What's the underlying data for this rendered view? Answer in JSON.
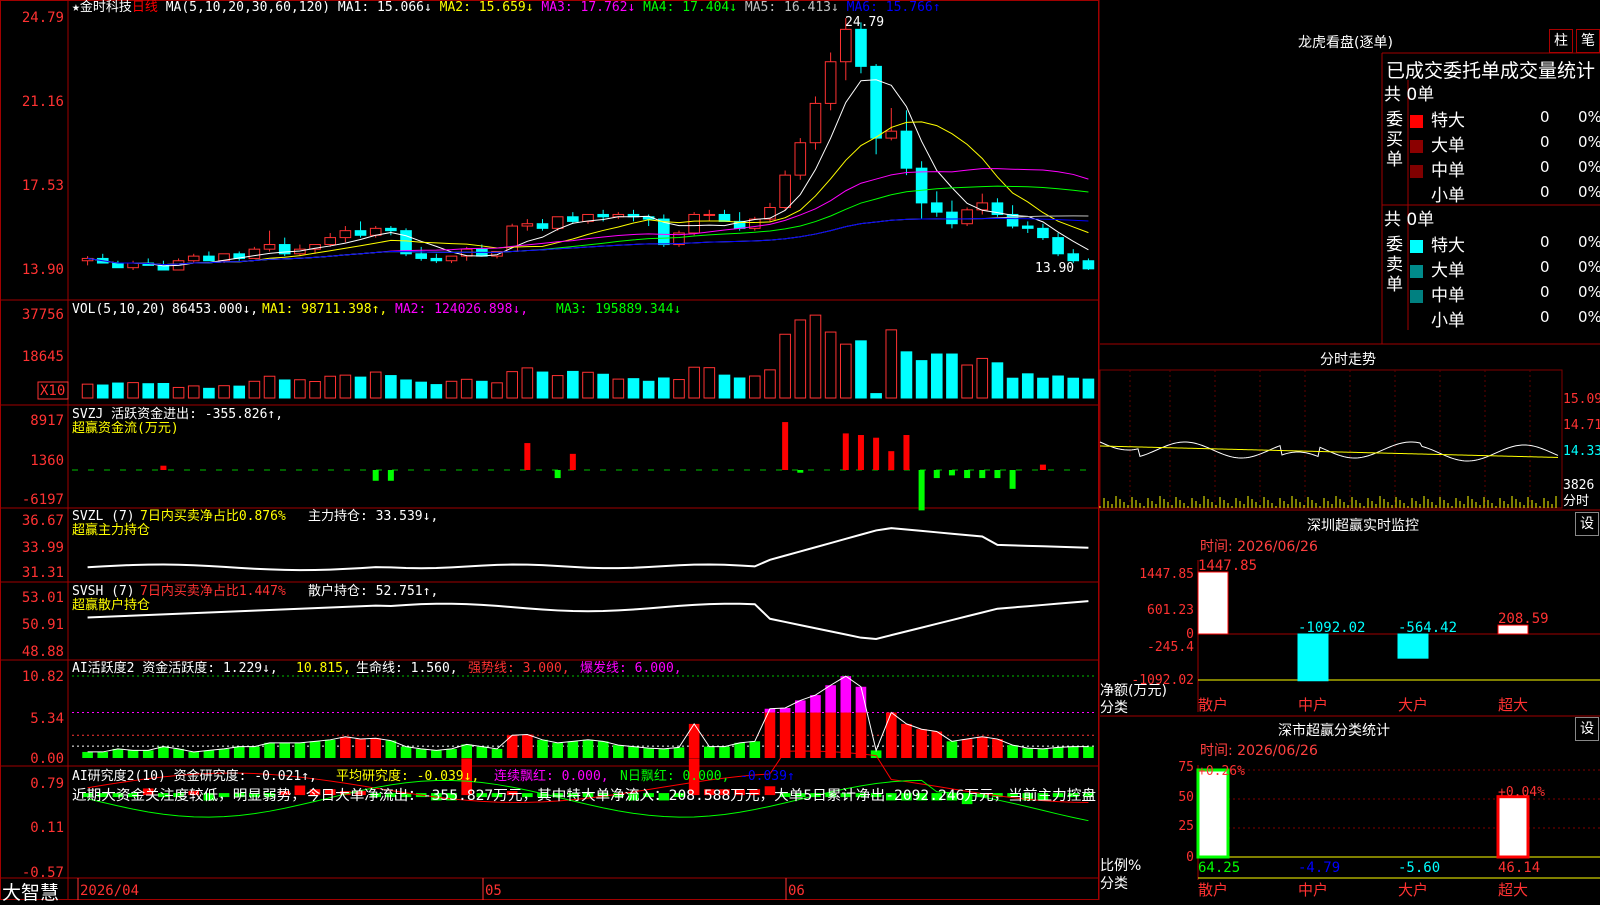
{
  "stock": {
    "star": "★",
    "name": "金时科技",
    "period": "日线"
  },
  "brand": "大智慧",
  "main_panel": {
    "ma_header": "MA(5,10,20,30,60,120)",
    "ma": [
      {
        "label": "MA1: 15.066",
        "arrow": "↓",
        "color": "#ffffff"
      },
      {
        "label": "MA2: 15.659",
        "arrow": "↓",
        "color": "#ffff00"
      },
      {
        "label": "MA3: 17.762",
        "arrow": "↓",
        "color": "#ff00ff"
      },
      {
        "label": "MA4: 17.404",
        "arrow": "↓",
        "color": "#00ff00"
      },
      {
        "label": "MA5: 16.413",
        "arrow": "↓",
        "color": "#c0c0c0"
      },
      {
        "label": "MA6: 15.766",
        "arrow": "↑",
        "color": "#0000ff"
      }
    ],
    "y_ticks": [
      "24.79",
      "21.16",
      "17.53",
      "13.90"
    ],
    "high_label": "24.79",
    "low_label": "13.90"
  },
  "vol_panel": {
    "header": "VOL(5,10,20)",
    "vol": "86453.000",
    "ma1": "MA1: 98711.398",
    "ma2": "MA2: 124026.898",
    "ma3": "MA3: 195889.344",
    "y_ticks": [
      "37756",
      "18645"
    ],
    "unit": "X10"
  },
  "svzj_panel": {
    "line1": "SVZJ  活跃资金进出: -355.826",
    "line2": "超赢资金流(万元)",
    "y_ticks": [
      "8917",
      "1360",
      "-6197"
    ]
  },
  "svzl_panel": {
    "prefix": "SVZL (7)",
    "p1": "7日内买卖净占比0.876%",
    "p2": "主力持仓: 33.539",
    "line2": "超赢主力持仓",
    "y_ticks": [
      "36.67",
      "33.99",
      "31.31"
    ]
  },
  "svsh_panel": {
    "prefix": "SVSH (7)",
    "p1": "7日内买卖净占比1.447%",
    "p2": "散户持仓: 52.751",
    "line2": "超赢散户持仓",
    "y_ticks": [
      "53.01",
      "50.91",
      "48.88"
    ]
  },
  "ai1_panel": {
    "h0": "AI活跃度2 资金活跃度: 1.229",
    "h1": "10.815",
    "h2": "生命线: 1.560",
    "h3": "强势线: 3.000",
    "h4": "爆发线: 6.000",
    "y_ticks": [
      "10.82",
      "5.34",
      "0.00"
    ]
  },
  "ai2_panel": {
    "h0": "AI研究度2(10) 资金研究度: -0.021",
    "h1": "平均研究度: -0.039",
    "h2": "连续飘红: 0.000",
    "h3": "N日飘红: 0.000",
    "h4": "-0.039",
    "comment": "近期大资金关注度较低，明显弱势，今日大单净流出：-355.827万元，其中特大单净流入：208.588万元，大单5日累计净出-2092.246万元，当前主力控盘",
    "y_ticks": [
      "0.79",
      "0.11",
      "-0.57"
    ]
  },
  "x_axis": {
    "d1": "2026/04",
    "d2": "05",
    "d3": "06"
  },
  "dragon": {
    "title": "龙虎看盘(逐单)",
    "btn1": "柱",
    "btn2": "笔",
    "subtitle": "已成交委托单成交量统计",
    "buy_label": "委买单",
    "sell_label": "委卖单",
    "buy_total": "共 0单",
    "sell_total": "共 0单",
    "buy_rows": [
      {
        "name": "特大",
        "val": "0",
        "pct": "0%",
        "color": "#ff0000"
      },
      {
        "name": "大单",
        "val": "0",
        "pct": "0%",
        "color": "#8b0000"
      },
      {
        "name": "中单",
        "val": "0",
        "pct": "0%",
        "color": "#800000"
      },
      {
        "name": "小单",
        "val": "0",
        "pct": "0%",
        "color": "#000000"
      }
    ],
    "sell_rows": [
      {
        "name": "特大",
        "val": "0",
        "pct": "0%",
        "color": "#00ffff"
      },
      {
        "name": "大单",
        "val": "0",
        "pct": "0%",
        "color": "#008b8b"
      },
      {
        "name": "中单",
        "val": "0",
        "pct": "0%",
        "color": "#008080"
      },
      {
        "name": "小单",
        "val": "0",
        "pct": "0%",
        "color": "#000000"
      }
    ]
  },
  "intraday": {
    "title": "分时走势",
    "y_ticks": [
      "15.09",
      "14.71",
      "14.33"
    ],
    "vol_tick": "3826",
    "vol_label": "分时"
  },
  "monitor": {
    "title": "深圳超赢实时监控",
    "btn": "设",
    "time": "时间: 2026/06/26",
    "y_ticks": [
      "1447.85",
      "601.23",
      "0",
      "-245.4",
      "-1092.02"
    ],
    "unit1": "净额(万元)",
    "unit2": "分类",
    "values": [
      "1447.85",
      "-1092.02",
      "-564.42",
      "208.59"
    ],
    "cats": [
      "散户",
      "中户",
      "大户",
      "超大"
    ]
  },
  "stats": {
    "title": "深市超赢分类统计",
    "btn": "设",
    "time": "时间: 2026/06/26",
    "y_ticks": [
      "75",
      "50",
      "25",
      "0"
    ],
    "unit1": "比例%",
    "unit2": "分类",
    "top_labels": [
      "+0.26%",
      "+0.04%"
    ],
    "values": [
      "64.25",
      "-4.79",
      "-5.60",
      "46.14"
    ],
    "cats": [
      "散户",
      "中户",
      "大户",
      "超大"
    ]
  },
  "chart_data": {
    "type": "candlestick",
    "ohlc": [
      [
        14.3,
        14.5,
        14.1,
        14.4
      ],
      [
        14.4,
        14.6,
        14.2,
        14.2
      ],
      [
        14.2,
        14.3,
        14.0,
        14.0
      ],
      [
        14.0,
        14.3,
        13.9,
        14.2
      ],
      [
        14.2,
        14.4,
        14.1,
        14.1
      ],
      [
        14.1,
        14.3,
        13.9,
        13.9
      ],
      [
        13.9,
        14.4,
        13.9,
        14.3
      ],
      [
        14.3,
        14.6,
        14.2,
        14.5
      ],
      [
        14.5,
        14.7,
        14.3,
        14.3
      ],
      [
        14.3,
        14.6,
        14.2,
        14.6
      ],
      [
        14.6,
        14.7,
        14.3,
        14.4
      ],
      [
        14.4,
        14.9,
        14.4,
        14.8
      ],
      [
        14.8,
        15.6,
        14.7,
        15.0
      ],
      [
        15.0,
        15.3,
        14.5,
        14.6
      ],
      [
        14.6,
        15.0,
        14.5,
        14.8
      ],
      [
        14.8,
        15.0,
        14.6,
        15.0
      ],
      [
        15.0,
        15.5,
        14.9,
        15.3
      ],
      [
        15.3,
        15.8,
        15.1,
        15.6
      ],
      [
        15.6,
        16.0,
        15.3,
        15.4
      ],
      [
        15.4,
        15.8,
        15.3,
        15.7
      ],
      [
        15.7,
        15.8,
        15.4,
        15.6
      ],
      [
        15.6,
        15.7,
        14.5,
        14.6
      ],
      [
        14.6,
        14.9,
        14.3,
        14.4
      ],
      [
        14.4,
        14.6,
        14.2,
        14.3
      ],
      [
        14.3,
        14.5,
        14.2,
        14.5
      ],
      [
        14.5,
        14.9,
        14.3,
        14.8
      ],
      [
        14.8,
        15.0,
        14.5,
        14.5
      ],
      [
        14.5,
        14.7,
        14.4,
        14.7
      ],
      [
        14.7,
        15.9,
        14.7,
        15.8
      ],
      [
        15.8,
        16.1,
        15.6,
        15.9
      ],
      [
        15.9,
        16.1,
        15.6,
        15.7
      ],
      [
        15.7,
        16.2,
        15.6,
        16.2
      ],
      [
        16.2,
        16.4,
        15.9,
        16.0
      ],
      [
        16.0,
        16.3,
        15.9,
        16.3
      ],
      [
        16.3,
        16.5,
        16.0,
        16.2
      ],
      [
        16.2,
        16.4,
        16.1,
        16.3
      ],
      [
        16.3,
        16.5,
        16.0,
        16.2
      ],
      [
        16.2,
        16.3,
        15.8,
        16.1
      ],
      [
        16.1,
        16.3,
        14.9,
        15.0
      ],
      [
        15.0,
        15.6,
        14.9,
        15.5
      ],
      [
        15.5,
        16.4,
        15.4,
        16.3
      ],
      [
        16.3,
        16.5,
        16.0,
        16.3
      ],
      [
        16.3,
        16.5,
        16.0,
        16.0
      ],
      [
        16.0,
        16.4,
        15.6,
        15.7
      ],
      [
        15.7,
        16.2,
        15.6,
        16.1
      ],
      [
        16.1,
        16.8,
        16.0,
        16.6
      ],
      [
        16.6,
        18.2,
        16.5,
        18.0
      ],
      [
        18.0,
        19.6,
        17.8,
        19.4
      ],
      [
        19.4,
        21.4,
        19.1,
        21.1
      ],
      [
        21.1,
        23.3,
        20.8,
        22.9
      ],
      [
        22.9,
        24.79,
        22.1,
        24.3
      ],
      [
        24.3,
        24.6,
        22.4,
        22.7
      ],
      [
        22.7,
        22.8,
        18.9,
        19.6
      ],
      [
        19.6,
        20.9,
        19.5,
        19.9
      ],
      [
        19.9,
        20.8,
        18.0,
        18.3
      ],
      [
        18.3,
        18.6,
        16.1,
        16.8
      ],
      [
        16.8,
        17.3,
        16.2,
        16.4
      ],
      [
        16.4,
        16.9,
        15.7,
        15.9
      ],
      [
        15.9,
        16.6,
        15.8,
        16.5
      ],
      [
        16.5,
        17.2,
        16.3,
        16.8
      ],
      [
        16.8,
        17.0,
        16.2,
        16.3
      ],
      [
        16.3,
        16.7,
        15.7,
        15.8
      ],
      [
        15.8,
        16.0,
        15.5,
        15.7
      ],
      [
        15.7,
        15.9,
        15.2,
        15.3
      ],
      [
        15.3,
        15.5,
        14.5,
        14.6
      ],
      [
        14.6,
        14.8,
        14.2,
        14.3
      ],
      [
        14.3,
        14.4,
        13.9,
        13.95
      ]
    ],
    "volume": [
      6.3,
      5.9,
      6.8,
      7.0,
      6.5,
      6.6,
      4.8,
      5.5,
      4.4,
      5.6,
      5.4,
      7.6,
      9.9,
      8.2,
      8.3,
      7.5,
      9.9,
      10.4,
      9.5,
      11.8,
      10.2,
      8.2,
      7.2,
      6.1,
      7.6,
      8.5,
      7.6,
      6.9,
      12.0,
      13.7,
      11.8,
      10.2,
      12.1,
      11.7,
      10.8,
      8.6,
      8.8,
      7.6,
      9.1,
      8.4,
      14.0,
      13.8,
      10.4,
      9.1,
      10.0,
      12.8,
      29.0,
      35.5,
      37.7,
      30.0,
      24.5,
      26.0,
      2.0,
      31.0,
      21.0,
      17.0,
      20.0,
      20.0,
      15.0,
      18.0,
      16.0,
      9.0,
      11.0,
      9.0,
      10.0,
      9.0,
      8.6
    ],
    "svzj": [
      0,
      0,
      0,
      0,
      0,
      800,
      0,
      0,
      0,
      0,
      0,
      0,
      0,
      0,
      0,
      0,
      0,
      0,
      0,
      -2000,
      -2000,
      0,
      0,
      0,
      0,
      0,
      0,
      0,
      0,
      5000,
      0,
      -1500,
      3000,
      0,
      0,
      0,
      0,
      0,
      0,
      0,
      0,
      0,
      0,
      0,
      0,
      0,
      8900,
      -500,
      0,
      0,
      6800,
      6500,
      6000,
      3500,
      6500,
      -7500,
      -1500,
      -1000,
      -1500,
      -1500,
      -1500,
      -3500,
      0,
      1000,
      0,
      0,
      0
    ],
    "ai1": [
      0.8,
      0.8,
      1.2,
      1.0,
      1.0,
      1.5,
      1.2,
      0.8,
      1.0,
      1.2,
      1.5,
      1.5,
      2.0,
      2.0,
      2.0,
      2.2,
      2.4,
      2.8,
      2.5,
      2.6,
      2.3,
      1.5,
      1.2,
      1.0,
      1.2,
      1.8,
      1.5,
      1.2,
      3.0,
      3.1,
      2.4,
      2.0,
      2.2,
      2.4,
      2.2,
      1.7,
      1.5,
      1.3,
      1.2,
      1.4,
      4.5,
      1.5,
      1.5,
      2.0,
      2.2,
      6.5,
      6.6,
      7.6,
      8.3,
      9.6,
      10.8,
      9.4,
      1.0,
      6.0,
      4.5,
      3.8,
      3.5,
      2.2,
      2.5,
      2.8,
      2.5,
      1.7,
      1.3,
      1.2,
      1.4,
      1.5,
      1.5
    ],
    "ai2": [
      -0.05,
      -0.05,
      -0.05,
      -0.05,
      0.09,
      -0.05,
      -0.02,
      0.05,
      -0.1,
      -0.03,
      -0.02,
      -0.03,
      -0.03,
      0.05,
      0.13,
      0.08,
      0.08,
      0.05,
      0.05,
      -0.02,
      -0.02,
      -0.02,
      -0.05,
      -0.1,
      -0.1,
      0.5,
      -0.05,
      -0.05,
      0.05,
      -0.05,
      -0.05,
      -0.05,
      -0.05,
      -0.05,
      -0.05,
      -0.05,
      -0.1,
      -0.05,
      -0.1,
      -0.05,
      0.5,
      0.08,
      0.08,
      0.08,
      0.08,
      0.12,
      -0.05,
      -0.05,
      -0.05,
      -0.05,
      -0.05,
      -0.05,
      -0.05,
      -0.1,
      -0.1,
      -0.1,
      -0.1,
      -0.1,
      -0.15,
      -0.05,
      -0.05,
      -0.05,
      -0.1,
      -0.1,
      -0.05,
      -0.05,
      -0.05
    ]
  }
}
